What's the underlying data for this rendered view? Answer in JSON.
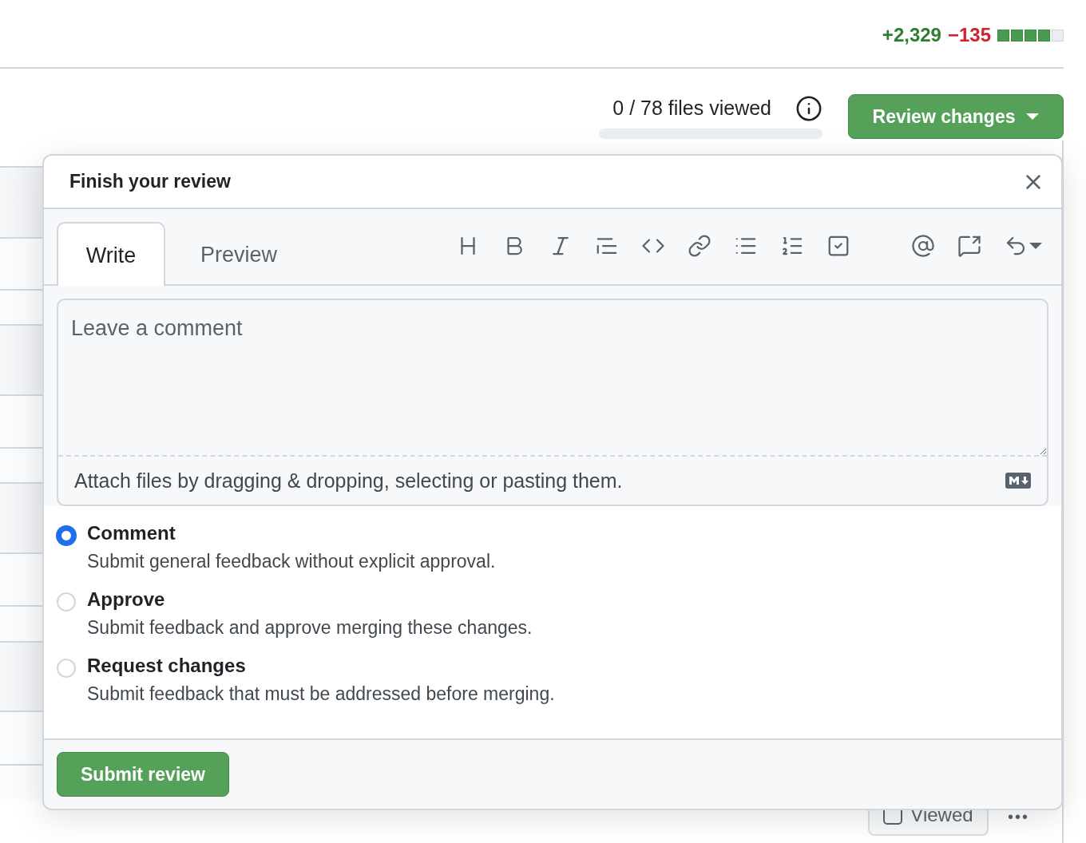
{
  "diffstat": {
    "additions": "+2,329",
    "deletions": "−135",
    "blocks": [
      {
        "filled": true
      },
      {
        "filled": true
      },
      {
        "filled": true
      },
      {
        "filled": true
      },
      {
        "filled": false
      }
    ]
  },
  "files_viewed": {
    "label": "0 / 78 files viewed",
    "level": 0
  },
  "review_button": {
    "label": "Review changes"
  },
  "file_header": {
    "viewed_label": "Viewed",
    "viewed_checked": false,
    "more": "•••"
  },
  "review_dialog": {
    "title": "Finish your review",
    "tabs": [
      {
        "label": "Write",
        "selected": true
      },
      {
        "label": "Preview",
        "selected": false
      }
    ],
    "comment": {
      "placeholder": "Leave a comment"
    },
    "attach_hint": "Attach files by dragging & dropping, selecting or pasting them.",
    "options": [
      {
        "label": "Comment",
        "description": "Submit general feedback without explicit approval.",
        "selected": true
      },
      {
        "label": "Approve",
        "description": "Submit feedback and approve merging these changes.",
        "selected": false
      },
      {
        "label": "Request changes",
        "description": "Submit feedback that must be addressed before merging.",
        "selected": false
      }
    ],
    "submit": "Submit review"
  }
}
